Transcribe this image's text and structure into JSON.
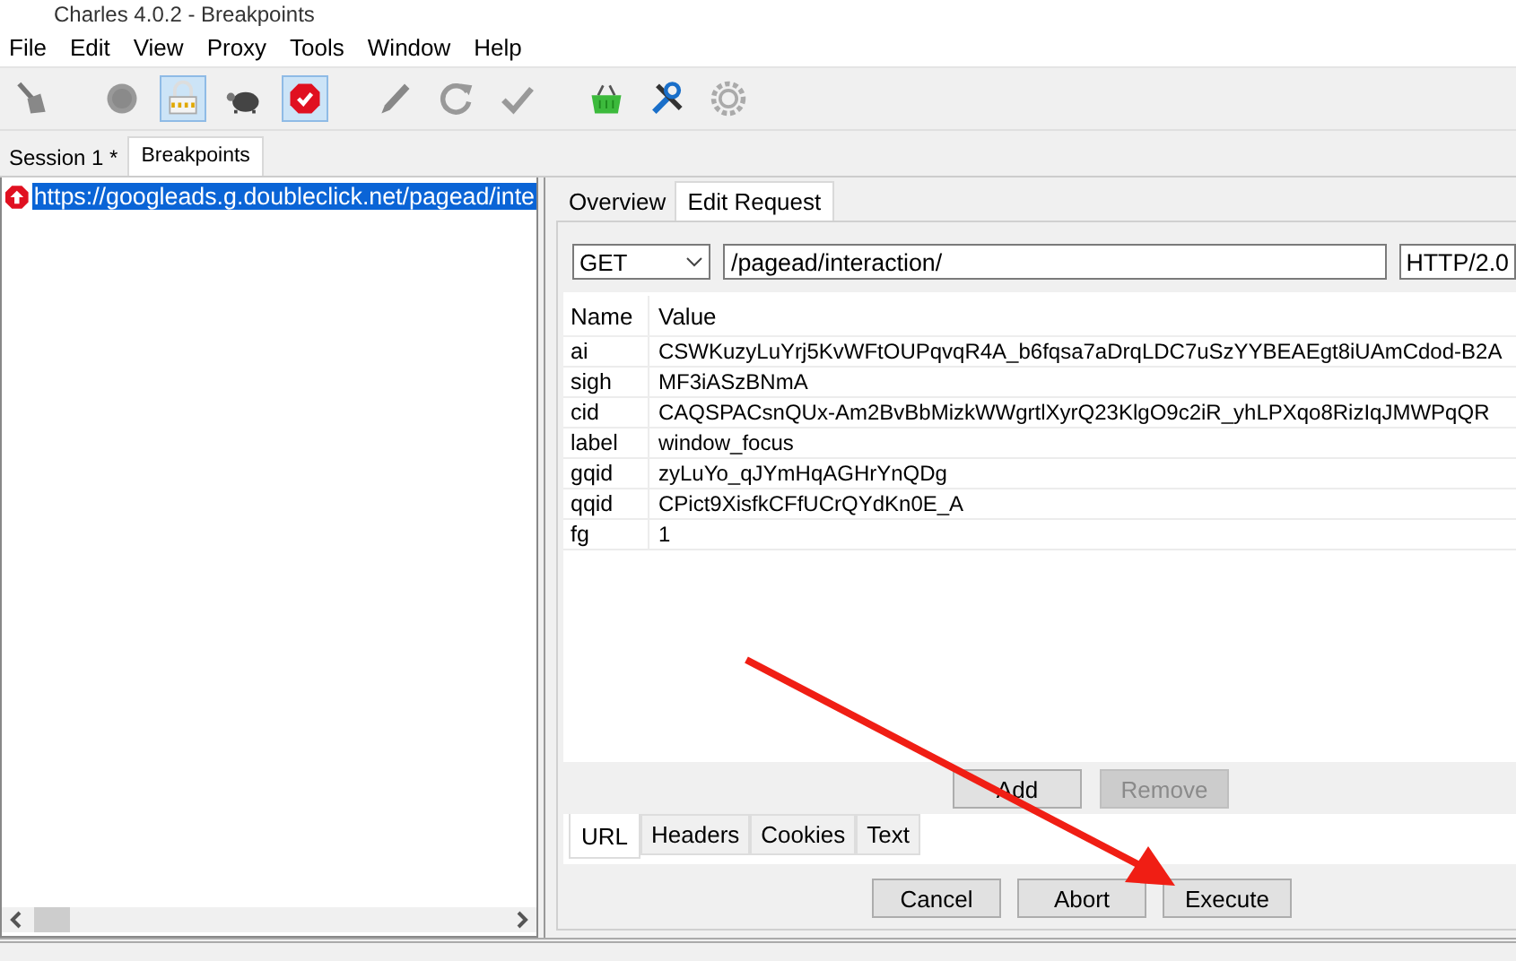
{
  "window": {
    "title": "Charles 4.0.2 - Breakpoints"
  },
  "menu": [
    "File",
    "Edit",
    "View",
    "Proxy",
    "Tools",
    "Window",
    "Help"
  ],
  "toolbar": [
    {
      "kind": "broom",
      "active": false
    },
    {
      "kind": "record",
      "active": false
    },
    {
      "kind": "lock",
      "active": true
    },
    {
      "kind": "turtle",
      "active": false
    },
    {
      "kind": "stop",
      "active": true
    },
    {
      "kind": "pen",
      "active": false
    },
    {
      "kind": "refresh",
      "active": false
    },
    {
      "kind": "check",
      "active": false
    },
    {
      "kind": "basket",
      "active": false
    },
    {
      "kind": "tools",
      "active": false
    },
    {
      "kind": "gear",
      "active": false
    }
  ],
  "session_tabs": [
    {
      "label": "Session 1 *",
      "selected": false
    },
    {
      "label": "Breakpoints",
      "selected": true
    }
  ],
  "breakpoints": [
    {
      "url": "https://googleads.g.doubleclick.net/pagead/inte",
      "selected": true
    }
  ],
  "detail_tabs": [
    {
      "label": "Overview",
      "selected": false
    },
    {
      "label": "Edit Request",
      "selected": true
    }
  ],
  "request": {
    "method": "GET",
    "path": "/pagead/interaction/",
    "protocol": "HTTP/2.0"
  },
  "params": {
    "columns": [
      "Name",
      "Value"
    ],
    "rows": [
      {
        "name": "ai",
        "value": "CSWKuzyLuYrj5KvWFtOUPqvqR4A_b6fqsa7aDrqLDC7uSzYYBEAEgt8iUAmCdod-B2A"
      },
      {
        "name": "sigh",
        "value": "MF3iASzBNmA"
      },
      {
        "name": "cid",
        "value": "CAQSPACsnQUx-Am2BvBbMizkWWgrtlXyrQ23KlgO9c2iR_yhLPXqo8RizIqJMWPqQR"
      },
      {
        "name": "label",
        "value": "window_focus"
      },
      {
        "name": "gqid",
        "value": "zyLuYo_qJYmHqAGHrYnQDg"
      },
      {
        "name": "qqid",
        "value": "CPict9XisfkCFfUCrQYdKn0E_A"
      },
      {
        "name": "fg",
        "value": "1"
      }
    ]
  },
  "row_buttons": [
    {
      "label": "Add",
      "disabled": false
    },
    {
      "label": "Remove",
      "disabled": true
    }
  ],
  "view_tabs": [
    {
      "label": "URL",
      "selected": true
    },
    {
      "label": "Headers",
      "selected": false
    },
    {
      "label": "Cookies",
      "selected": false
    },
    {
      "label": "Text",
      "selected": false
    }
  ],
  "action_buttons": [
    "Cancel",
    "Abort",
    "Execute"
  ]
}
